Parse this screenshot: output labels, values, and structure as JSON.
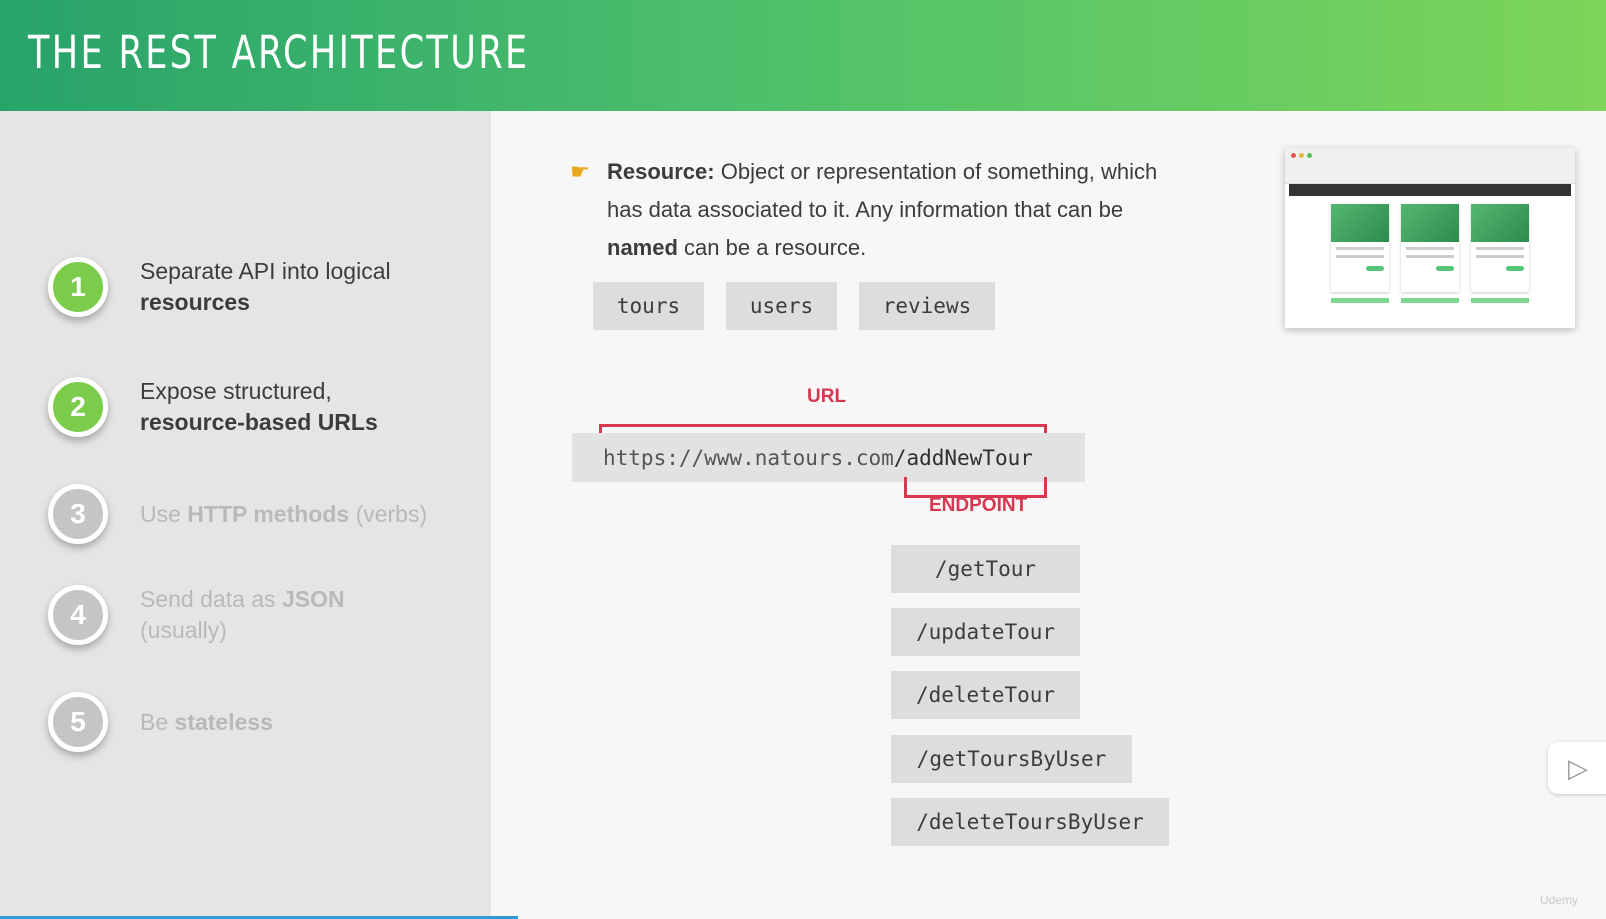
{
  "header": {
    "title": "THE REST ARCHITECTURE"
  },
  "steps": [
    {
      "number": "1",
      "text": "Separate API into logical",
      "bold": "resources"
    },
    {
      "number": "2",
      "text": "Expose structured,",
      "bold": "resource-based URLs"
    },
    {
      "number": "3",
      "pre": "Use",
      "bold": "HTTP methods",
      "post": "(verbs)"
    },
    {
      "number": "4",
      "pre": "Send data as",
      "bold": "JSON",
      "post": "(usually)"
    },
    {
      "number": "5",
      "pre": "Be",
      "bold": "stateless"
    }
  ],
  "resource": {
    "term": "Resource:",
    "text1": "Object or representation of something, which has data associated to it. Any information that can be",
    "named": "named",
    "text2": "can be a resource."
  },
  "resources": [
    "tours",
    "users",
    "reviews"
  ],
  "url": {
    "label": "URL",
    "base": "https://www.natours.com",
    "endpoint": "/addNewTour",
    "endpoint_label": "ENDPOINT"
  },
  "endpoints": [
    "/getTour",
    "/updateTour",
    "/deleteTour",
    "/getToursByUser",
    "/deleteToursByUser"
  ],
  "watermark": "Udemy",
  "colors": {
    "accent": "#d93650",
    "green": "#7ccc4c",
    "header_start": "#28a36a",
    "header_end": "#7dd55a"
  },
  "icons": {
    "pointer": "pointing-hand-icon",
    "play": "play-icon"
  }
}
